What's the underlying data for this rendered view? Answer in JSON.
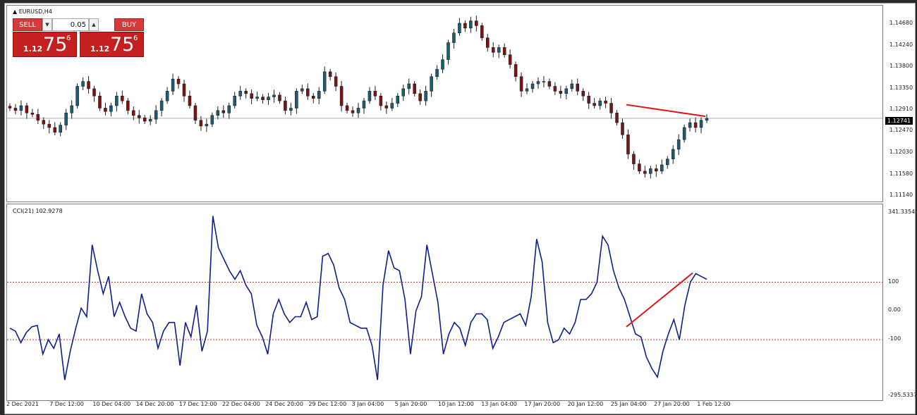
{
  "chart_title": "EURUSD,H4",
  "indicator_title": "CCI(21) 102.9278",
  "trade_panel": {
    "sell_label": "SELL",
    "buy_label": "BUY",
    "volume": "0.05",
    "sell_price_small": "1.12",
    "sell_price_big": "75",
    "sell_price_sup": "6",
    "buy_price_small": "1.12",
    "buy_price_big": "75",
    "buy_price_sup": "6"
  },
  "price_axis": [
    "1.14680",
    "1.14240",
    "1.13800",
    "1.13350",
    "1.12910",
    "1.12470",
    "1.12030",
    "1.11580",
    "1.11140"
  ],
  "current_price": "1.12741",
  "cci_axis": [
    "341.3354",
    "100",
    "0.00",
    "-100",
    "-295.5337"
  ],
  "time_axis": [
    "2 Dec 2021",
    "7 Dec 12:00",
    "10 Dec 04:00",
    "14 Dec 20:00",
    "17 Dec 12:00",
    "22 Dec 04:00",
    "24 Dec 20:00",
    "29 Dec 12:00",
    "3 Jan 04:00",
    "5 Jan 20:00",
    "10 Jan 12:00",
    "13 Jan 04:00",
    "17 Jan 20:00",
    "20 Jan 12:00",
    "25 Jan 04:00",
    "27 Jan 20:00",
    "1 Feb 12:00"
  ],
  "colors": {
    "bull": "#1f5a73",
    "bear": "#7a1414",
    "cci_line": "#0d1f8c",
    "trendline": "#e01515",
    "level_line": "#c43c3c"
  },
  "chart_data": [
    {
      "type": "candlestick",
      "title": "EURUSD,H4",
      "ylim": [
        1.1114,
        1.1486
      ],
      "close_series": [
        1.1295,
        1.129,
        1.13,
        1.1285,
        1.1282,
        1.127,
        1.1262,
        1.1255,
        1.1245,
        1.126,
        1.1285,
        1.13,
        1.134,
        1.135,
        1.1335,
        1.132,
        1.1295,
        1.1288,
        1.13,
        1.132,
        1.131,
        1.129,
        1.128,
        1.1275,
        1.1268,
        1.1272,
        1.129,
        1.131,
        1.133,
        1.1355,
        1.1345,
        1.132,
        1.13,
        1.127,
        1.1258,
        1.1262,
        1.128,
        1.129,
        1.1285,
        1.13,
        1.132,
        1.133,
        1.1325,
        1.1315,
        1.1318,
        1.1312,
        1.1318,
        1.1322,
        1.131,
        1.129,
        1.1295,
        1.133,
        1.1335,
        1.132,
        1.1315,
        1.133,
        1.137,
        1.136,
        1.134,
        1.13,
        1.129,
        1.1285,
        1.1295,
        1.131,
        1.133,
        1.132,
        1.13,
        1.1295,
        1.1305,
        1.132,
        1.1335,
        1.1345,
        1.1325,
        1.131,
        1.133,
        1.136,
        1.1375,
        1.1395,
        1.143,
        1.145,
        1.147,
        1.146,
        1.1475,
        1.1465,
        1.144,
        1.142,
        1.141,
        1.142,
        1.1405,
        1.1385,
        1.136,
        1.133,
        1.1335,
        1.1345,
        1.135,
        1.135,
        1.134,
        1.133,
        1.1325,
        1.1335,
        1.1345,
        1.133,
        1.132,
        1.1305,
        1.13,
        1.131,
        1.1305,
        1.1285,
        1.1265,
        1.124,
        1.12,
        1.118,
        1.1165,
        1.116,
        1.117,
        1.1165,
        1.1178,
        1.119,
        1.121,
        1.123,
        1.1255,
        1.1265,
        1.1255,
        1.127,
        1.1274
      ]
    },
    {
      "type": "line",
      "title": "CCI(21) 102.9278",
      "ylim": [
        -295.5337,
        341.3354
      ],
      "levels": [
        100,
        -100
      ],
      "values": [
        -60,
        -70,
        -110,
        -75,
        -55,
        -50,
        -150,
        -100,
        -130,
        -80,
        -240,
        -140,
        -60,
        10,
        -20,
        230,
        140,
        60,
        120,
        -20,
        30,
        -20,
        -60,
        -70,
        60,
        -10,
        -40,
        -130,
        -70,
        -40,
        -40,
        -190,
        -40,
        -90,
        20,
        -140,
        -70,
        330,
        220,
        180,
        140,
        110,
        140,
        90,
        60,
        -50,
        -90,
        -150,
        -10,
        40,
        -10,
        -40,
        -20,
        -20,
        30,
        -30,
        -20,
        190,
        200,
        160,
        80,
        40,
        -40,
        -50,
        -60,
        -60,
        -120,
        -240,
        90,
        210,
        150,
        140,
        40,
        -150,
        0,
        50,
        230,
        130,
        30,
        -150,
        -80,
        -40,
        -60,
        -120,
        -40,
        -10,
        -10,
        -30,
        -130,
        -90,
        -40,
        -30,
        -20,
        -10,
        -50,
        50,
        250,
        170,
        -40,
        -110,
        -100,
        -60,
        -80,
        -40,
        40,
        40,
        60,
        100,
        260,
        230,
        140,
        80,
        40,
        -20,
        -80,
        -90,
        -160,
        -200,
        -230,
        -140,
        -80,
        -30,
        -100,
        20,
        100,
        130,
        120,
        110
      ]
    }
  ]
}
